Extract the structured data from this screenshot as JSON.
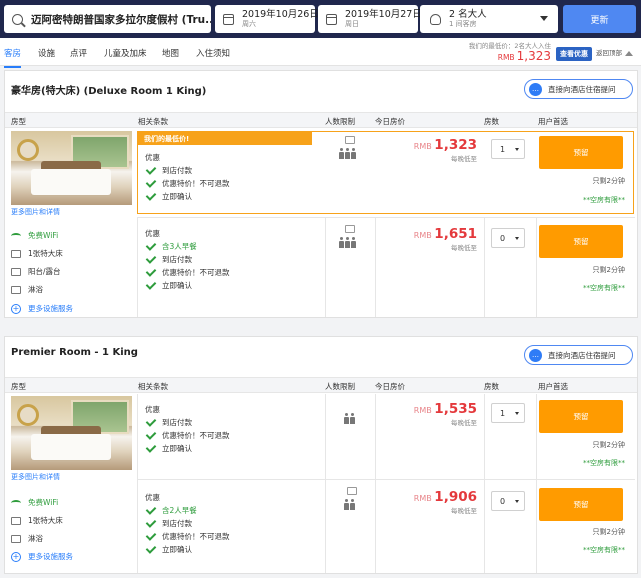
{
  "search": {
    "hotel": "迈阿密特朗普国家多拉尔度假村 (Tru..."
  },
  "checkin": {
    "date": "2019年10月26日",
    "weekday": "周六"
  },
  "checkout": {
    "date": "2019年10月27日",
    "weekday": "周日"
  },
  "guests": {
    "main": "2 名大人",
    "sub": "1 间客房"
  },
  "update_label": "更新",
  "tabs": [
    "客房",
    "设施",
    "点评",
    "儿童及加床",
    "地图",
    "入住须知"
  ],
  "min_price": {
    "label": "我们的最低价：2名大人入住",
    "currency": "RMB",
    "value": "1,323"
  },
  "view_offers_label": "查看优惠",
  "back_top_label": "返回顶部",
  "ask_label": "直接向酒店住宿提问",
  "colheads": {
    "room": "房型",
    "terms": "相关条款",
    "occupancy": "人数限制",
    "price": "今日房价",
    "rooms": "房数",
    "choice": "用户首选"
  },
  "common": {
    "more_photos": "更多图片和详情",
    "more_facilities": "更多设施服务",
    "per_night": "每晚低至",
    "book": "预留",
    "only_left": "只剩2分钟",
    "free_cancel": "**空房有限**",
    "offer": "优惠"
  },
  "rooms": [
    {
      "title": "豪华房(特大床) (Deluxe Room 1 King)",
      "amenities": [
        "免费WiFi",
        "1张特大床",
        "阳台/露台",
        "淋浴"
      ],
      "rates": [
        {
          "badge": "我们的最低价!",
          "terms": [
            "到店付款",
            "优惠特价！不可退款",
            "立即确认"
          ],
          "currency": "RMB",
          "price": "1,323",
          "qty": "1"
        },
        {
          "breakfast": "含3人早餐",
          "terms": [
            "到店付款",
            "优惠特价！不可退款",
            "立即确认"
          ],
          "currency": "RMB",
          "price": "1,651",
          "qty": "0"
        }
      ]
    },
    {
      "title": "Premier Room - 1 King",
      "amenities": [
        "免费WiFi",
        "1张特大床",
        "淋浴"
      ],
      "rates": [
        {
          "terms": [
            "到店付款",
            "优惠特价！不可退款",
            "立即确认"
          ],
          "currency": "RMB",
          "price": "1,535",
          "qty": "1"
        },
        {
          "breakfast": "含2人早餐",
          "terms": [
            "到店付款",
            "优惠特价！不可退款",
            "立即确认"
          ],
          "currency": "RMB",
          "price": "1,906",
          "qty": "0"
        }
      ]
    }
  ]
}
